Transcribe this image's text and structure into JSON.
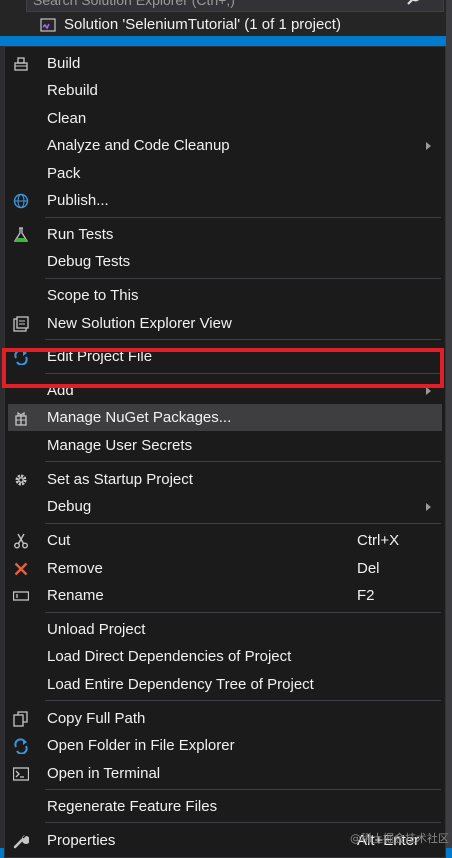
{
  "explorer": {
    "search_placeholder": "Search Solution Explorer (Ctrl+;)",
    "solution_label": "Solution 'SeleniumTutorial' (1 of 1 project)"
  },
  "menu": {
    "build": "Build",
    "rebuild": "Rebuild",
    "clean": "Clean",
    "analyze": "Analyze and Code Cleanup",
    "pack": "Pack",
    "publish": "Publish...",
    "run_tests": "Run Tests",
    "debug_tests": "Debug Tests",
    "scope": "Scope to This",
    "new_view": "New Solution Explorer View",
    "edit_project": "Edit Project File",
    "add": "Add",
    "nuget": "Manage NuGet Packages...",
    "user_secrets": "Manage User Secrets",
    "startup": "Set as Startup Project",
    "debug": "Debug",
    "cut": "Cut",
    "cut_shortcut": "Ctrl+X",
    "remove": "Remove",
    "remove_shortcut": "Del",
    "rename": "Rename",
    "rename_shortcut": "F2",
    "unload": "Unload Project",
    "load_direct": "Load Direct Dependencies of Project",
    "load_entire": "Load Entire Dependency Tree of Project",
    "copy_path": "Copy Full Path",
    "open_folder": "Open Folder in File Explorer",
    "open_terminal": "Open in Terminal",
    "regenerate": "Regenerate Feature Files",
    "properties": "Properties",
    "properties_shortcut": "Alt+Enter"
  },
  "watermark": "@稀土掘金技术社区",
  "colors": {
    "menu_bg": "#1b1b1c",
    "highlight": "#3e3e40",
    "annotation_frame": "#e21f26",
    "accent_blue": "#007acc"
  }
}
